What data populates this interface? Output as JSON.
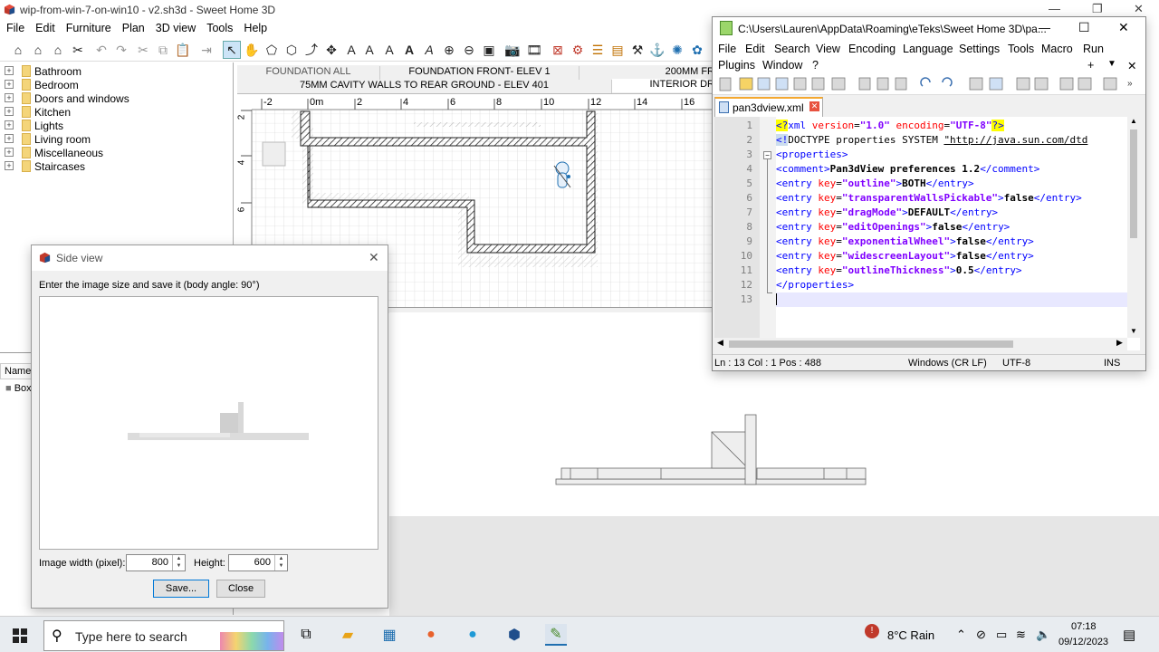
{
  "main_window": {
    "title": "wip-from-win-7-on-win10 - v2.sh3d - Sweet Home 3D",
    "menu": [
      "File",
      "Edit",
      "Furniture",
      "Plan",
      "3D view",
      "Tools",
      "Help"
    ]
  },
  "furniture_catalog": {
    "categories": [
      "Bathroom",
      "Bedroom",
      "Doors and windows",
      "Kitchen",
      "Lights",
      "Living room",
      "Miscellaneous",
      "Staircases"
    ]
  },
  "furniture_list": {
    "column_name": "Name",
    "first_item": "Box"
  },
  "plan": {
    "tabs_row1": [
      "FOUNDATION ALL",
      "FOUNDATION FRONT- ELEV 1",
      "200MM FR"
    ],
    "tabs_row2": [
      "75MM CAVITY WALLS TO REAR GROUND - ELEV 401",
      "INTERIOR DR"
    ],
    "ruler_x": [
      "-2",
      "0m",
      "2",
      "4",
      "6",
      "8",
      "10",
      "12",
      "14",
      "16"
    ],
    "ruler_y": [
      "2",
      "4",
      "6"
    ]
  },
  "side_view_dialog": {
    "title": "Side view",
    "instruction": "Enter the image size and save it (body angle: 90°)",
    "width_label": "Image width (pixel):",
    "width_value": "800",
    "height_label": "Height:",
    "height_value": "600",
    "save_label": "Save...",
    "close_label": "Close"
  },
  "notepad": {
    "title": "C:\\Users\\Lauren\\AppData\\Roaming\\eTeks\\Sweet Home 3D\\pa...",
    "menu_row1": [
      "File",
      "Edit",
      "Search",
      "View",
      "Encoding",
      "Language",
      "Settings",
      "Tools",
      "Macro",
      "Run"
    ],
    "menu_row2": [
      "Plugins",
      "Window",
      "?"
    ],
    "tab": "pan3dview.xml",
    "line_numbers": [
      "1",
      "2",
      "3",
      "4",
      "5",
      "6",
      "7",
      "8",
      "9",
      "10",
      "11",
      "12",
      "13"
    ],
    "status": {
      "position": "Ln : 13    Col : 1    Pos : 488",
      "eol": "Windows (CR LF)",
      "encoding": "UTF-8",
      "mode": "INS"
    }
  },
  "taskbar": {
    "search_placeholder": "Type here to search",
    "weather": "8°C  Rain",
    "time": "07:18",
    "date": "09/12/2023"
  },
  "colors": {
    "wall_hatch": "#222222",
    "npp_tag": "#0000ff",
    "npp_attr": "#ff0000",
    "npp_value": "#8000ff",
    "taskbar": "#e8ecf0"
  }
}
